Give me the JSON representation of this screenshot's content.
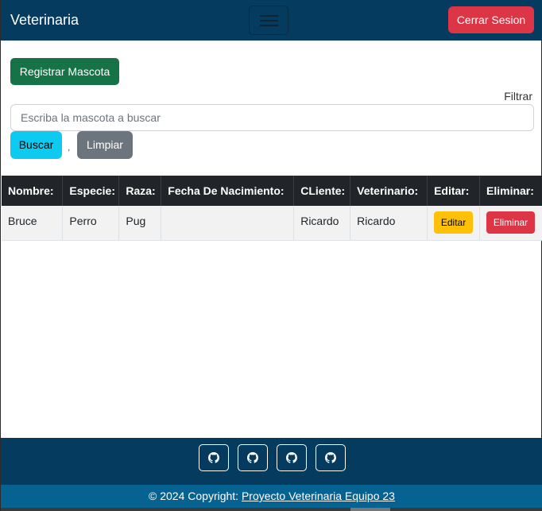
{
  "navbar": {
    "brand": "Veterinaria",
    "logout_label": "Cerrar Sesion"
  },
  "main": {
    "register_label": "Registrar Mascota",
    "filter_label": "Filtrar",
    "search_placeholder": "Escriba la mascota a buscar",
    "search_value": "",
    "search_button": "Buscar",
    "separator": ",",
    "clear_button": "Limpiar"
  },
  "table": {
    "headers": [
      "Nombre:",
      "Especie:",
      "Raza:",
      "Fecha De Nacimiento:",
      "CLiente:",
      "Veterinario:",
      "Editar:",
      "Eliminar:"
    ],
    "rows": [
      {
        "nombre": "Bruce",
        "especie": "Perro",
        "raza": "Pug",
        "fecha": "",
        "cliente": "Ricardo",
        "veterinario": "Ricardo",
        "edit_label": "Editar",
        "delete_label": "Eliminar"
      }
    ]
  },
  "footer": {
    "social_icons": [
      "github-icon",
      "github-icon",
      "github-icon",
      "github-icon"
    ],
    "copyright_prefix": "© 2024 Copyright: ",
    "copyright_link": "Proyecto Veterinaria Equipo 23"
  },
  "colors": {
    "navbar_bg": "#053b5f",
    "danger": "#dc3545",
    "success": "#157347",
    "info": "#0dcaf0",
    "secondary": "#6c757d",
    "warning": "#ffc107",
    "table_head": "#212529",
    "copyright_bg": "#066391"
  }
}
